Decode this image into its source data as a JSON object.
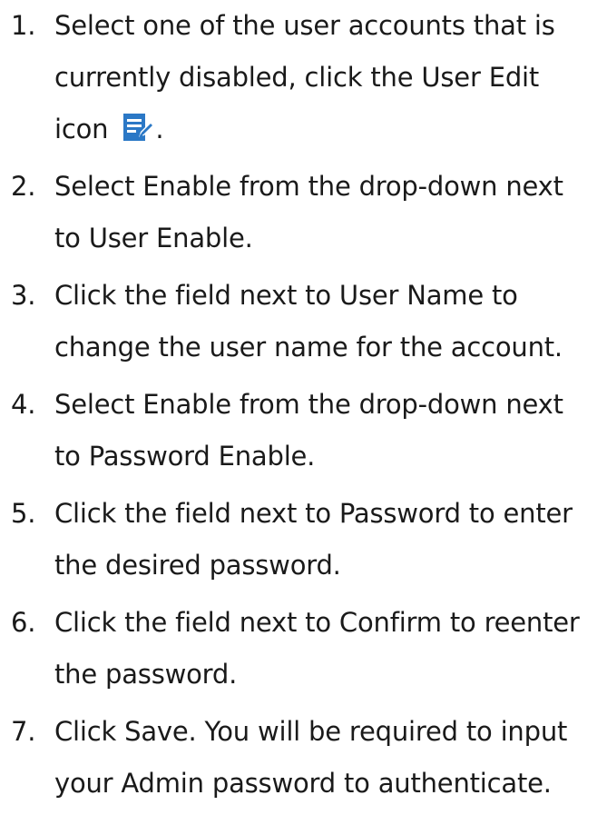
{
  "steps": [
    {
      "number": "1.",
      "line1": "Select one of the user accounts that is",
      "line2": "currently disabled, click the User Edit",
      "line3_before_icon": "icon",
      "line3_after_icon": ".",
      "icon": "user-edit-icon"
    },
    {
      "number": "2.",
      "line1": "Select Enable from the drop-down next",
      "line2": "to User Enable."
    },
    {
      "number": "3.",
      "line1": "Click the field next to User Name to",
      "line2": "change the user name for the account."
    },
    {
      "number": "4.",
      "line1": "Select Enable from the drop-down next",
      "line2": "to Password Enable."
    },
    {
      "number": "5.",
      "line1": "Click the field next to Password to enter",
      "line2": "the desired password."
    },
    {
      "number": "6.",
      "line1": "Click the field next to Confirm to reenter",
      "line2": "the password."
    },
    {
      "number": "7.",
      "line1": "Click Save. You will be required to input",
      "line2": "your Admin password to authenticate."
    }
  ],
  "colors": {
    "text": "#1a1a1a",
    "icon_blue": "#2b78c6"
  }
}
